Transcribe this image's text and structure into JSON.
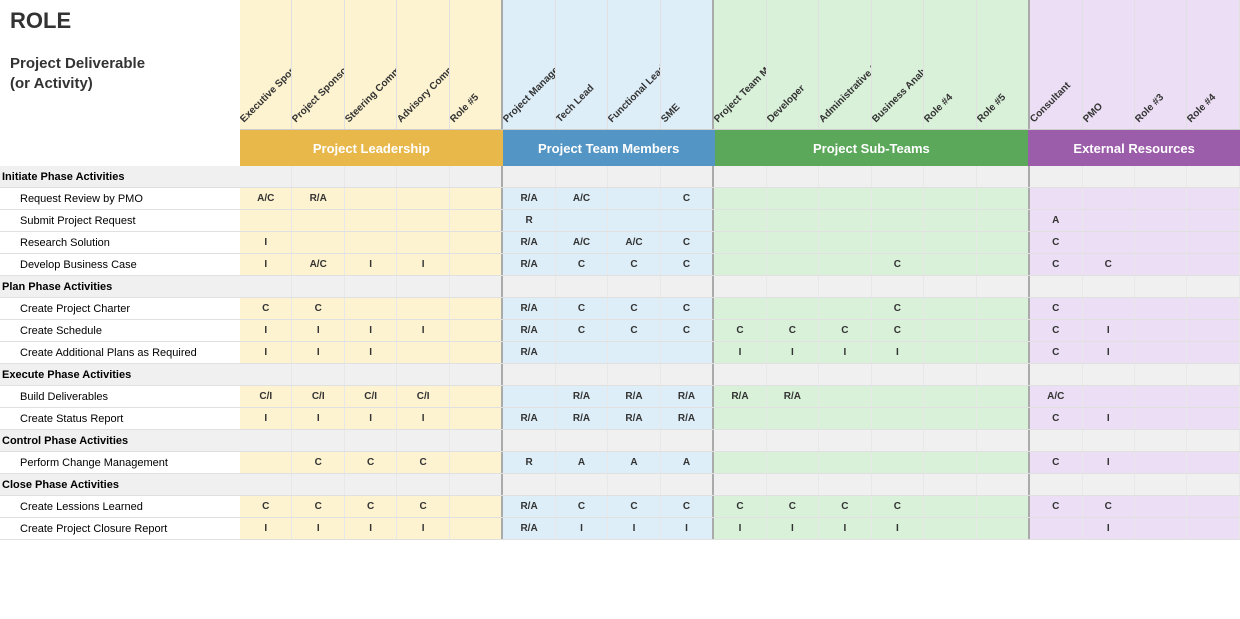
{
  "title": "ROLE",
  "deliverable_label": "Project Deliverable\n(or Activity)",
  "groups": [
    {
      "name": "Project Leadership",
      "color": "#e8b84b",
      "text_color": "#fff",
      "cols": 5
    },
    {
      "name": "Project Team Members",
      "color": "#5395c4",
      "text_color": "#fff",
      "cols": 4
    },
    {
      "name": "Project Sub-Teams",
      "color": "#5ba85b",
      "text_color": "#fff",
      "cols": 6
    },
    {
      "name": "External Resources",
      "color": "#9b5caa",
      "text_color": "#fff",
      "cols": 4
    }
  ],
  "columns": [
    {
      "label": "Executive Sponsor",
      "group": "leadership"
    },
    {
      "label": "Project Sponsor",
      "group": "leadership"
    },
    {
      "label": "Steering Committee",
      "group": "leadership"
    },
    {
      "label": "Advisory Committee",
      "group": "leadership"
    },
    {
      "label": "Role #5",
      "group": "leadership"
    },
    {
      "label": "Project Manager",
      "group": "team"
    },
    {
      "label": "Tech Lead",
      "group": "team"
    },
    {
      "label": "Functional Lead",
      "group": "team"
    },
    {
      "label": "SME",
      "group": "team"
    },
    {
      "label": "Project Team Member",
      "group": "subteams"
    },
    {
      "label": "Developer",
      "group": "subteams"
    },
    {
      "label": "Administrative Support",
      "group": "subteams"
    },
    {
      "label": "Business Analyst",
      "group": "subteams"
    },
    {
      "label": "Role #4",
      "group": "subteams"
    },
    {
      "label": "Role #5",
      "group": "subteams"
    },
    {
      "label": "Consultant",
      "group": "external"
    },
    {
      "label": "PMO",
      "group": "external"
    },
    {
      "label": "Role #3",
      "group": "external"
    },
    {
      "label": "Role #4",
      "group": "external"
    }
  ],
  "rows": [
    {
      "label": "Initiate Phase Activities",
      "type": "phase"
    },
    {
      "label": "Request Review by PMO",
      "type": "activity",
      "cells": [
        "A/C",
        "R/A",
        "",
        "",
        "",
        "R/A",
        "A/C",
        "",
        "C",
        "",
        "",
        "",
        "",
        "",
        "",
        "",
        "",
        "",
        ""
      ]
    },
    {
      "label": "Submit Project Request",
      "type": "activity",
      "cells": [
        "",
        "",
        "",
        "",
        "",
        "R",
        "",
        "",
        "",
        "",
        "",
        "",
        "",
        "",
        "",
        "A",
        "",
        "",
        ""
      ]
    },
    {
      "label": "Research Solution",
      "type": "activity",
      "cells": [
        "I",
        "",
        "",
        "",
        "",
        "R/A",
        "A/C",
        "A/C",
        "C",
        "",
        "",
        "",
        "",
        "",
        "",
        "C",
        "",
        "",
        ""
      ]
    },
    {
      "label": "Develop Business Case",
      "type": "activity",
      "cells": [
        "I",
        "A/C",
        "I",
        "I",
        "",
        "R/A",
        "C",
        "C",
        "C",
        "",
        "",
        "",
        "C",
        "",
        "",
        "C",
        "C",
        "",
        ""
      ]
    },
    {
      "label": "Plan Phase Activities",
      "type": "phase"
    },
    {
      "label": "Create Project Charter",
      "type": "activity",
      "cells": [
        "C",
        "C",
        "",
        "",
        "",
        "R/A",
        "C",
        "C",
        "C",
        "",
        "",
        "",
        "C",
        "",
        "",
        "C",
        "",
        "",
        ""
      ]
    },
    {
      "label": "Create Schedule",
      "type": "activity",
      "cells": [
        "I",
        "I",
        "I",
        "I",
        "",
        "R/A",
        "C",
        "C",
        "C",
        "C",
        "C",
        "C",
        "C",
        "",
        "",
        "C",
        "I",
        "",
        ""
      ]
    },
    {
      "label": "Create Additional Plans as Required",
      "type": "activity",
      "cells": [
        "I",
        "I",
        "I",
        "",
        "",
        "R/A",
        "",
        "",
        "",
        "I",
        "I",
        "I",
        "I",
        "",
        "",
        "C",
        "I",
        "",
        ""
      ]
    },
    {
      "label": "Execute Phase Activities",
      "type": "phase"
    },
    {
      "label": "Build Deliverables",
      "type": "activity",
      "cells": [
        "C/I",
        "C/I",
        "C/I",
        "C/I",
        "",
        "",
        "R/A",
        "R/A",
        "R/A",
        "R/A",
        "R/A",
        "",
        "",
        "",
        "",
        "A/C",
        "",
        "",
        ""
      ]
    },
    {
      "label": "Create Status Report",
      "type": "activity",
      "cells": [
        "I",
        "I",
        "I",
        "I",
        "",
        "R/A",
        "R/A",
        "R/A",
        "R/A",
        "",
        "",
        "",
        "",
        "",
        "",
        "C",
        "I",
        "",
        ""
      ]
    },
    {
      "label": "Control Phase Activities",
      "type": "phase"
    },
    {
      "label": "Perform Change Management",
      "type": "activity",
      "cells": [
        "",
        "C",
        "C",
        "C",
        "",
        "R",
        "A",
        "A",
        "A",
        "",
        "",
        "",
        "",
        "",
        "",
        "C",
        "I",
        "",
        ""
      ]
    },
    {
      "label": "Close Phase Activities",
      "type": "phase"
    },
    {
      "label": "Create Lessions Learned",
      "type": "activity",
      "cells": [
        "C",
        "C",
        "C",
        "C",
        "",
        "R/A",
        "C",
        "C",
        "C",
        "C",
        "C",
        "C",
        "C",
        "",
        "",
        "C",
        "C",
        "",
        ""
      ]
    },
    {
      "label": "Create Project Closure Report",
      "type": "activity",
      "cells": [
        "I",
        "I",
        "I",
        "I",
        "",
        "R/A",
        "I",
        "I",
        "I",
        "I",
        "I",
        "I",
        "I",
        "",
        "",
        "",
        "I",
        "",
        ""
      ]
    }
  ]
}
